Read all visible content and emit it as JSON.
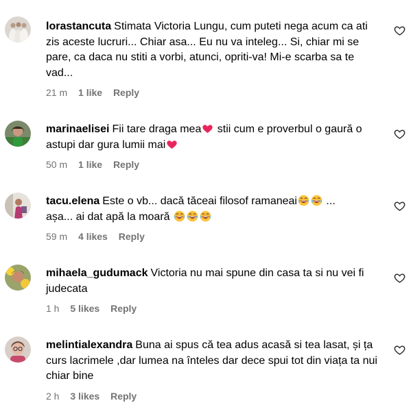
{
  "comments": [
    {
      "username": "lorastancuta",
      "text_parts": [
        "Stimata Victoria Lungu, cum puteti nega acum ca ati zis aceste lucruri... Chiar asa... Eu nu va inteleg... Si, chiar mi se pare, ca daca nu stiti a vorbi, atunci, opriti-va! Mi-e scarba sa te vad..."
      ],
      "time": "21 m",
      "likes": "1 like",
      "reply": "Reply"
    },
    {
      "username": "marinaelisei",
      "text_parts": [
        "Fii tare draga mea",
        " stii cum e proverbul o gaură o astupi dar gura lumii mai"
      ],
      "emojis": [
        "heart-emoji",
        "heart-emoji"
      ],
      "time": "50 m",
      "likes": "1 like",
      "reply": "Reply"
    },
    {
      "username": "tacu.elena",
      "text_parts": [
        "Este o vb... dacă tăceai filosof ramaneai",
        " ...",
        "așa... ai dat apă la moară"
      ],
      "emojis": [
        "laughing-emoji",
        "laughing-emoji",
        "laughing-emoji",
        "laughing-emoji",
        "laughing-emoji"
      ],
      "time": "59 m",
      "likes": "4 likes",
      "reply": "Reply"
    },
    {
      "username": "mihaela_gudumack",
      "text_parts": [
        "Victoria nu mai spune din casa ta si nu vei fi judecata"
      ],
      "time": "1 h",
      "likes": "5 likes",
      "reply": "Reply"
    },
    {
      "username": "melintialexandra",
      "text_parts": [
        "Buna ai spus că tea adus acasă si tea lasat, și ța curs lacrimele ,dar lumea na înteles dar dece spui tot din viața ta nui chiar bine"
      ],
      "time": "2 h",
      "likes": "3 likes",
      "reply": "Reply"
    }
  ],
  "colors": {
    "text": "#000000",
    "meta": "#737373",
    "heart_emoji": "#e8265e",
    "laugh_emoji": "#f9c23c"
  }
}
